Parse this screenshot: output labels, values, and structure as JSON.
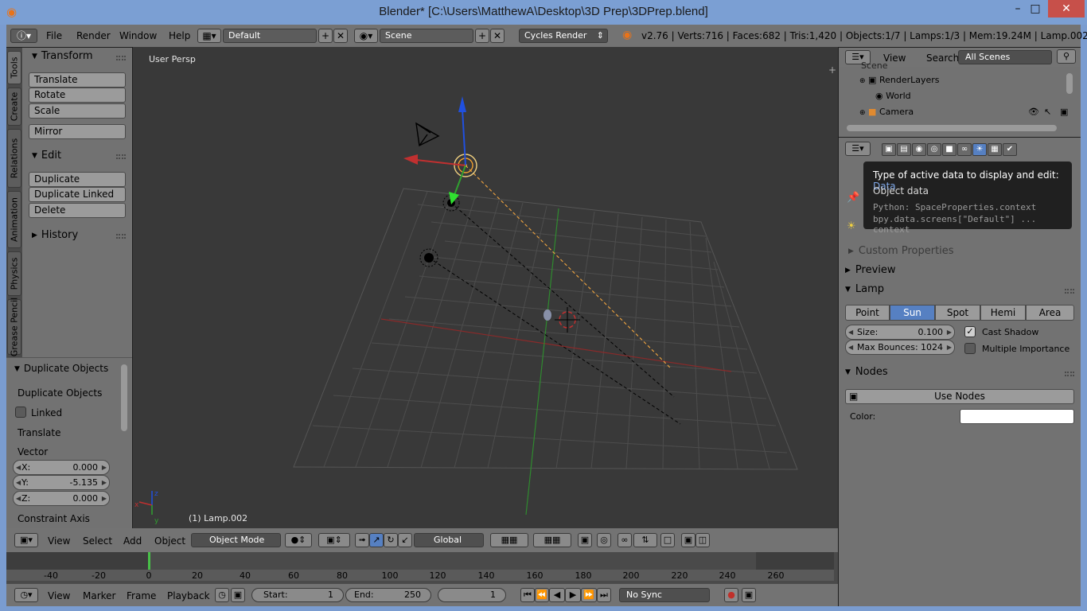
{
  "window": {
    "title": "Blender* [C:\\Users\\MatthewA\\Desktop\\3D Prep\\3DPrep.blend]",
    "minimize": "–",
    "maximize": "□",
    "close": "✕"
  },
  "menubar": {
    "items": [
      "File",
      "Render",
      "Window",
      "Help"
    ],
    "layout": "Default",
    "scene": "Scene",
    "engine": "Cycles Render",
    "info": "v2.76 | Verts:716 | Faces:682 | Tris:1,420 | Objects:1/7 | Lamps:1/3 | Mem:19.24M | Lamp.002"
  },
  "tool_tabs": [
    "Tools",
    "Create",
    "Relations",
    "Animation",
    "Physics",
    "Grease Pencil"
  ],
  "toolshelf": {
    "transform": {
      "title": "Transform",
      "buttons": [
        "Translate",
        "Rotate",
        "Scale",
        "Mirror"
      ]
    },
    "edit": {
      "title": "Edit",
      "buttons": [
        "Duplicate",
        "Duplicate Linked",
        "Delete"
      ]
    },
    "history": {
      "title": "History"
    }
  },
  "redo_panel": {
    "title": "Duplicate Objects",
    "operator": "Duplicate Objects",
    "linked": "Linked",
    "translate": "Translate",
    "vector": "Vector",
    "x_label": "X:",
    "x": "0.000",
    "y_label": "Y:",
    "y": "-5.135",
    "z_label": "Z:",
    "z": "0.000",
    "constraint": "Constraint Axis"
  },
  "viewport": {
    "view_name": "User Persp",
    "active_object": "(1) Lamp.002",
    "axis_x": "x",
    "axis_y": "y",
    "axis_z": "z"
  },
  "viewport_header": {
    "menus": [
      "View",
      "Select",
      "Add",
      "Object"
    ],
    "mode": "Object Mode",
    "orientation": "Global"
  },
  "timeline": {
    "ticks": [
      "-40",
      "-20",
      "0",
      "20",
      "40",
      "60",
      "80",
      "100",
      "120",
      "140",
      "160",
      "180",
      "200",
      "220",
      "240",
      "260"
    ],
    "current_frame_marker": 0,
    "menus": [
      "View",
      "Marker",
      "Frame",
      "Playback"
    ],
    "start_label": "Start:",
    "start": "1",
    "end_label": "End:",
    "end": "250",
    "current": "1",
    "sync": "No Sync"
  },
  "outliner": {
    "menus": [
      "View",
      "Search"
    ],
    "filter": "All Scenes",
    "items": [
      "Scene",
      "RenderLayers",
      "World",
      "Camera"
    ]
  },
  "properties": {
    "sections": {
      "custom": "Custom Properties",
      "preview": "Preview",
      "lamp": "Lamp",
      "nodes": "Nodes"
    },
    "lamp_types": [
      "Point",
      "Sun",
      "Spot",
      "Hemi",
      "Area"
    ],
    "active_lamp_type": "Sun",
    "size_label": "Size:",
    "size": "0.100",
    "bounces_label": "Max Bounces:",
    "bounces": "1024",
    "cast_shadow": "Cast Shadow",
    "multiple_importance": "Multiple Importance",
    "use_nodes": "Use Nodes",
    "color_label": "Color:",
    "color_value": "#ffffff"
  },
  "tooltip": {
    "line1": "Type of active data to display and edit:",
    "line1_value": "Data",
    "line2": "Object data",
    "python1": "Python: SpaceProperties.context",
    "python2": "bpy.data.screens[\"Default\"] ... context"
  },
  "colors": {
    "accent": "#5680c2",
    "selection": "#f0a030",
    "x_axis": "#c03030",
    "y_axis": "#30a030",
    "z_axis": "#2050e0"
  }
}
